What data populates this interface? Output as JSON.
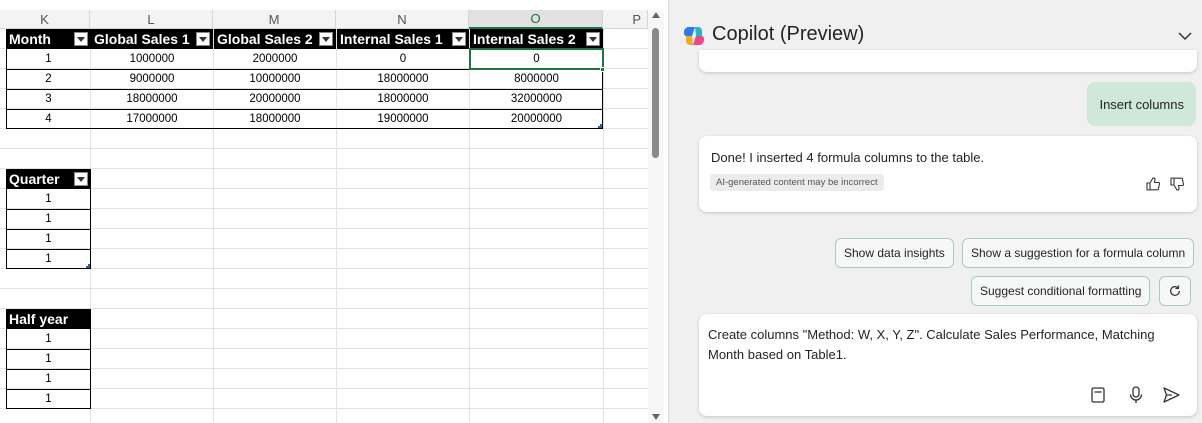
{
  "sheet": {
    "columns": [
      "K",
      "L",
      "M",
      "N",
      "O",
      "P"
    ],
    "table1": {
      "headers": [
        "Month",
        "Global Sales 1",
        "Global Sales 2",
        "Internal Sales 1",
        "Internal Sales 2"
      ],
      "rows": [
        [
          "1",
          "1000000",
          "2000000",
          "0",
          "0"
        ],
        [
          "2",
          "9000000",
          "10000000",
          "18000000",
          "8000000"
        ],
        [
          "3",
          "18000000",
          "20000000",
          "18000000",
          "32000000"
        ],
        [
          "4",
          "17000000",
          "18000000",
          "19000000",
          "20000000"
        ]
      ]
    },
    "quarter": {
      "header": "Quarter",
      "values": [
        "1",
        "1",
        "1",
        "1"
      ]
    },
    "halfyear": {
      "header": "Half year",
      "values": [
        "1",
        "1",
        "1",
        "1"
      ]
    }
  },
  "copilot": {
    "title": "Copilot (Preview)",
    "user_message": "Insert columns",
    "reply": "Done! I inserted 4 formula columns to the table.",
    "disclaimer": "AI-generated content may be incorrect",
    "suggestions": [
      "Show data insights",
      "Show a suggestion for a formula column",
      "Suggest conditional formatting"
    ],
    "input_text": "Create columns \"Method: W, X, Y, Z\". Calculate Sales Performance, Matching Month based on Table1.",
    "accent": "#217346"
  }
}
